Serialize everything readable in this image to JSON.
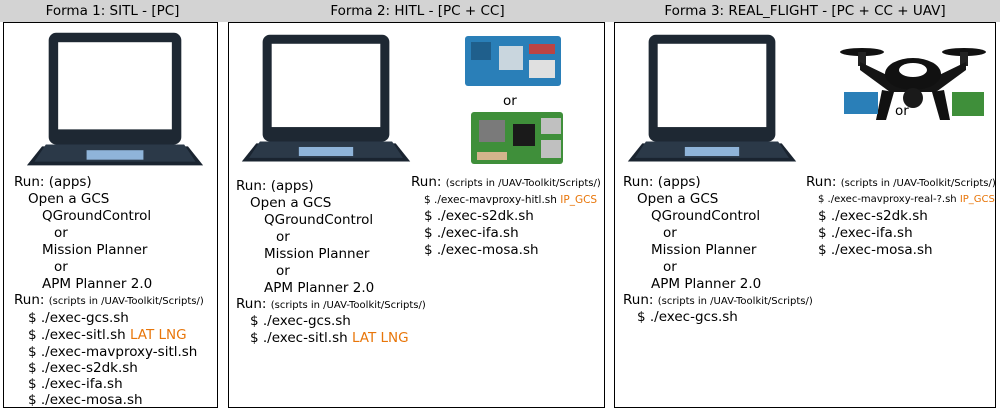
{
  "forms": [
    {
      "title": "Forma 1: SITL - [PC]",
      "run_apps": "Run: (apps)",
      "open_gcs": "Open a GCS",
      "apps": [
        "QGroundControl",
        "or",
        "Mission Planner",
        "or",
        "APM Planner 2.0"
      ],
      "run_scripts": "Run:",
      "scripts_note": "(scripts in /UAV-Toolkit/Scripts/)",
      "commands": [
        "$ ./exec-gcs.sh",
        "$ ./exec-sitl.sh",
        "$ ./exec-mavproxy-sitl.sh",
        "$ ./exec-s2dk.sh",
        "$ ./exec-ifa.sh",
        "$ ./exec-mosa.sh"
      ],
      "sitl_args": "LAT LNG"
    },
    {
      "title": "Forma 2: HITL - [PC + CC]",
      "run_apps": "Run: (apps)",
      "open_gcs": "Open a GCS",
      "apps": [
        "QGroundControl",
        "or",
        "Mission Planner",
        "or",
        "APM Planner 2.0"
      ],
      "run_scripts": "Run:",
      "scripts_note": "(scripts in /UAV-Toolkit/Scripts/)",
      "commands": [
        "$ ./exec-gcs.sh",
        "$ ./exec-sitl.sh"
      ],
      "sitl_args": "LAT LNG",
      "cc_or": "or",
      "cc_run": "Run:",
      "cc_scripts_note": "(scripts in /UAV-Toolkit/Scripts/)",
      "cc_commands": [
        "$ ./exec-mavproxy-hitl.sh",
        "$ ./exec-s2dk.sh",
        "$ ./exec-ifa.sh",
        "$ ./exec-mosa.sh"
      ],
      "cc_arg": "IP_GCS"
    },
    {
      "title": "Forma 3: REAL_FLIGHT - [PC + CC + UAV]",
      "run_apps": "Run: (apps)",
      "open_gcs": "Open a GCS",
      "apps": [
        "QGroundControl",
        "or",
        "Mission Planner",
        "or",
        "APM Planner 2.0"
      ],
      "run_scripts": "Run:",
      "scripts_note": "(scripts in /UAV-Toolkit/Scripts/)",
      "commands": [
        "$ ./exec-gcs.sh"
      ],
      "cc_or": "or",
      "cc_run": "Run:",
      "cc_scripts_note": "(scripts in /UAV-Toolkit/Scripts/)",
      "cc_commands": [
        "$ ./exec-mavproxy-real-?.sh",
        "$ ./exec-s2dk.sh",
        "$ ./exec-ifa.sh",
        "$ ./exec-mosa.sh"
      ],
      "cc_arg": "IP_GCS"
    }
  ],
  "colors": {
    "accent": "#e8760a",
    "title_bg": "#d3d3d3",
    "board_blue": "#2a7fb8",
    "board_green": "#3f8f3a"
  }
}
